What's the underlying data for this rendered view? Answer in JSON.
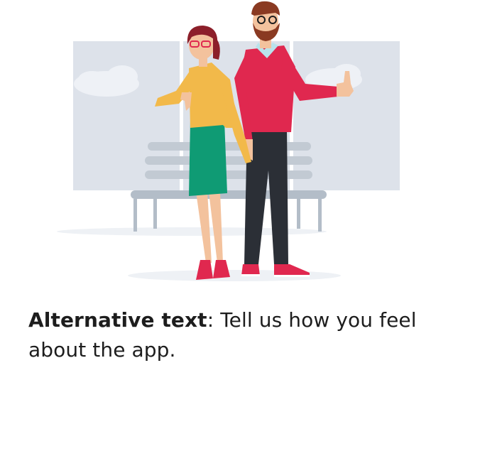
{
  "caption": {
    "label": "Alternative text",
    "separator": ":",
    "text": " Tell us how you feel about the app."
  },
  "illustration": {
    "subject": "two people giving thumbs down and thumbs up in front of a bench",
    "colors": {
      "window": "#dde2ea",
      "window_frame": "#ffffff",
      "bench": "#b9c3cd",
      "woman_top": "#f2b94a",
      "woman_skirt": "#0f9b74",
      "woman_hair": "#8c1f2a",
      "man_sweater": "#e0284f",
      "man_pants": "#2b2f36",
      "skin": "#f3c29d",
      "shoes": "#e0284f"
    }
  }
}
